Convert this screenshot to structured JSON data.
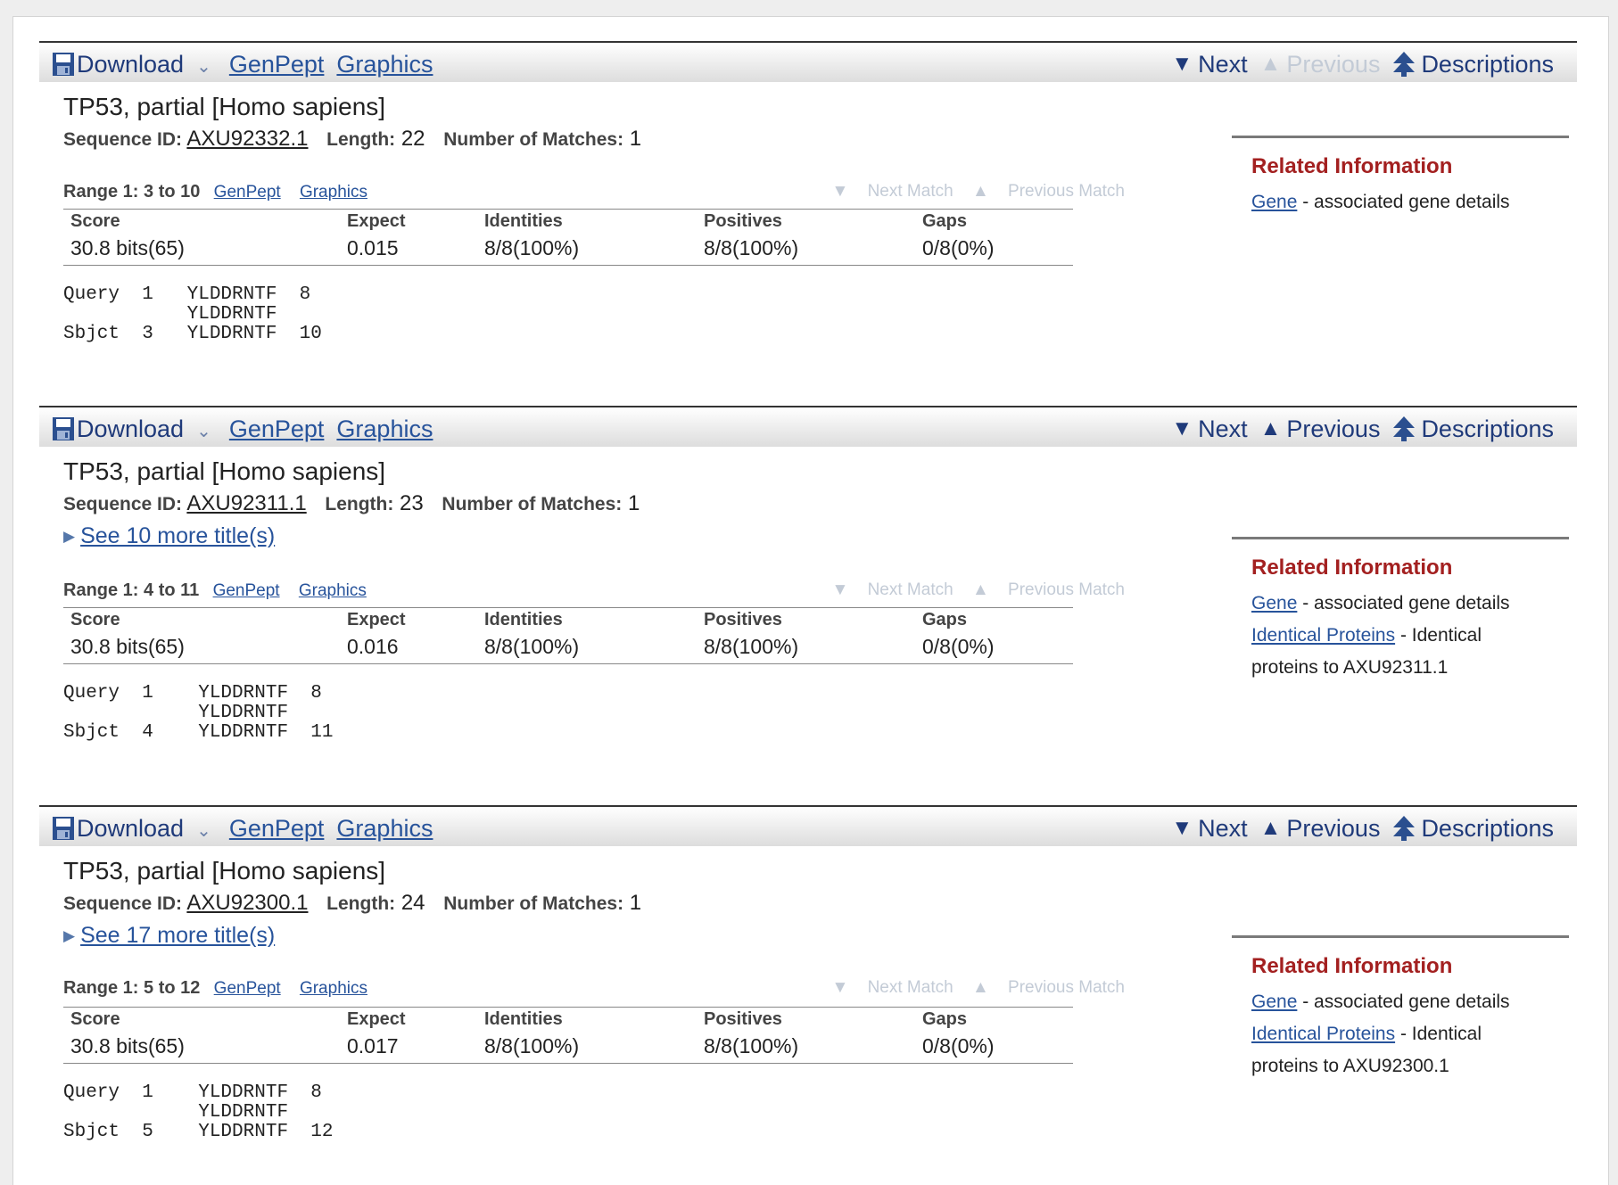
{
  "toolbar_common": {
    "download": "Download",
    "genpept": "GenPept",
    "graphics": "Graphics",
    "next": "Next",
    "previous": "Previous",
    "descriptions": "Descriptions"
  },
  "labels": {
    "sequence_id": "Sequence ID:",
    "length": "Length:",
    "num_matches": "Number of Matches:",
    "score": "Score",
    "expect": "Expect",
    "identities": "Identities",
    "positives": "Positives",
    "gaps": "Gaps",
    "next_match": "Next Match",
    "previous_match": "Previous Match",
    "range_genpept": "GenPept",
    "range_graphics": "Graphics",
    "related_information": "Related Information",
    "gene": "Gene",
    "gene_desc": "- associated gene details",
    "identical_proteins": "Identical Proteins",
    "identical_desc_prefix": "- Identical"
  },
  "hits": [
    {
      "title": "TP53, partial [Homo sapiens]",
      "sequence_id": "AXU92332.1",
      "length": "22",
      "num_matches": "1",
      "previous_disabled": true,
      "range": "Range 1: 3 to 10",
      "score": "30.8 bits(65)",
      "expect": "0.015",
      "identities": "8/8(100%)",
      "positives": "8/8(100%)",
      "gaps": "0/8(0%)",
      "alignment": "Query  1   YLDDRNTF  8\n           YLDDRNTF\nSbjct  3   YLDDRNTF  10"
    },
    {
      "title": "TP53, partial [Homo sapiens]",
      "sequence_id": "AXU92311.1",
      "length": "23",
      "num_matches": "1",
      "more_titles": "See 10 more title(s)",
      "range": "Range 1: 4 to 11",
      "score": "30.8 bits(65)",
      "expect": "0.016",
      "identities": "8/8(100%)",
      "positives": "8/8(100%)",
      "gaps": "0/8(0%)",
      "alignment": "Query  1    YLDDRNTF  8\n            YLDDRNTF\nSbjct  4    YLDDRNTF  11",
      "identical_text": "proteins to AXU92311.1"
    },
    {
      "title": "TP53, partial [Homo sapiens]",
      "sequence_id": "AXU92300.1",
      "length": "24",
      "num_matches": "1",
      "more_titles": "See 17 more title(s)",
      "range": "Range 1: 5 to 12",
      "score": "30.8 bits(65)",
      "expect": "0.017",
      "identities": "8/8(100%)",
      "positives": "8/8(100%)",
      "gaps": "0/8(0%)",
      "alignment": "Query  1    YLDDRNTF  8\n            YLDDRNTF\nSbjct  5    YLDDRNTF  12",
      "identical_text": "proteins to AXU92300.1"
    }
  ]
}
